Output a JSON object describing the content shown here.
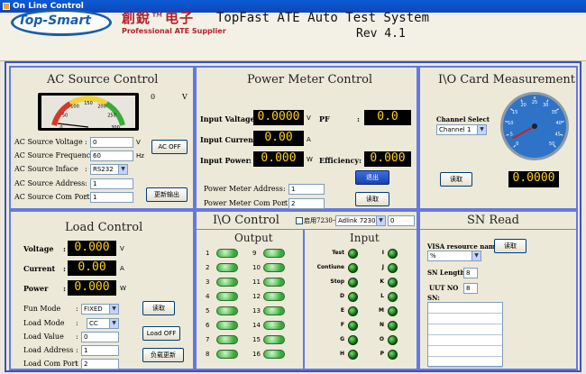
{
  "window": {
    "title": "On Line Control"
  },
  "header": {
    "logo_text": "Top-Smart",
    "company_cn": "創銳™电子",
    "company_en": "Professional ATE Supplier",
    "system_title": "TopFast ATE Auto Test System",
    "revision": "Rev 4.1"
  },
  "ac_source": {
    "title": "AC Source Control",
    "gauge_readout": "0",
    "gauge_unit": "V",
    "gauge_ticks": [
      "0",
      "50",
      "100",
      "150",
      "200",
      "250",
      "300"
    ],
    "voltage_label": "AC Source Voltage",
    "voltage_value": "0",
    "voltage_unit": "V",
    "freq_label": "AC Source Frequency:",
    "freq_value": "60",
    "freq_unit": "Hz",
    "interface_label": "AC Source Inface",
    "interface_value": "RS232",
    "address_label": "AC Source Address",
    "address_value": "1",
    "com_label": "AC Source Com Port",
    "com_value": "1",
    "ac_off_button": "AC OFF",
    "update_button": "更新输出"
  },
  "power_meter": {
    "title": "Power Meter Control",
    "input_voltage_label": "Input Valtage:",
    "input_voltage_value": "0.0000",
    "input_voltage_unit": "V",
    "pf_label": "PF",
    "pf_value": "0.0",
    "input_current_label": "Input Current:",
    "input_current_value": "0.00",
    "input_current_unit": "A",
    "input_power_label": "Input Power",
    "input_power_value": "0.000",
    "input_power_unit": "W",
    "efficiency_label": "Efficiency:",
    "efficiency_value": "0.000",
    "exit_button": "退出",
    "address_label": "Power Meter Address",
    "address_value": "1",
    "com_label": "Power Meter Com Port",
    "com_value": "2",
    "read_button": "读取"
  },
  "io_card": {
    "title": "I\\O Card Measurement",
    "channel_label": "Channel Select",
    "channel_value": "Channel 1",
    "read_button": "读取",
    "display_value": "0.0000",
    "gauge_ticks": [
      "0",
      "5",
      "10",
      "15",
      "20",
      "25",
      "30",
      "35",
      "40",
      "45",
      "50"
    ],
    "gauge_level": 0.06
  },
  "load_control": {
    "title": "Load Control",
    "voltage_label": "Voltage",
    "voltage_value": "0.000",
    "voltage_unit": "V",
    "current_label": "Current",
    "current_value": "0.00",
    "current_unit": "A",
    "power_label": "Power",
    "power_value": "0.000",
    "power_unit": "W",
    "fun_mode_label": "Fun Mode",
    "fun_mode_value": "FIXED",
    "load_mode_label": "Load Mode",
    "load_mode_value": "CC",
    "load_value_label": "Load Value",
    "load_value_value": "0",
    "load_address_label": "Load Address",
    "load_address_value": "1",
    "load_com_label": "Load Com Port",
    "load_com_value": "2",
    "read_button": "读取",
    "load_off_button": "Load OFF",
    "update_button": "负载更新"
  },
  "io_control": {
    "title": "I\\O Control",
    "enable_label": "启用7230卡",
    "card_value": "Adlink 7230",
    "card_number": "0",
    "output_title": "Output",
    "outputs_left": [
      "1",
      "2",
      "3",
      "4",
      "5",
      "6",
      "7",
      "8"
    ],
    "outputs_right": [
      "9",
      "10",
      "11",
      "12",
      "13",
      "14",
      "15",
      "16"
    ],
    "input_title": "Input",
    "inputs_left": [
      "Test",
      "Contiune",
      "Stop",
      "D",
      "E",
      "F",
      "G",
      "H"
    ],
    "inputs_right": [
      "I",
      "J",
      "K",
      "L",
      "M",
      "N",
      "O",
      "P"
    ]
  },
  "sn_read": {
    "title": "SN Read",
    "visa_label": "VISA resource name",
    "visa_value": "%",
    "read_button": "读取",
    "sn_length_label": "SN Length:",
    "sn_length_value": "8",
    "uut_label": "UUT NO",
    "uut_value": "8",
    "sn_label": "SN:"
  }
}
